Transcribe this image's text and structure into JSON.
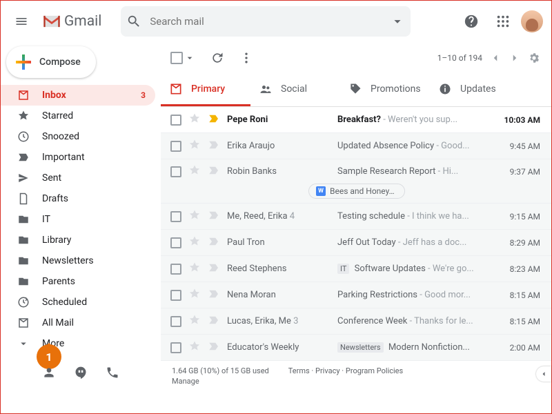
{
  "header": {
    "app_name": "Gmail",
    "search_placeholder": "Search mail"
  },
  "compose_label": "Compose",
  "sidebar": {
    "items": [
      {
        "label": "Inbox",
        "count": "3"
      },
      {
        "label": "Starred"
      },
      {
        "label": "Snoozed"
      },
      {
        "label": "Important"
      },
      {
        "label": "Sent"
      },
      {
        "label": "Drafts"
      },
      {
        "label": "IT"
      },
      {
        "label": "Library"
      },
      {
        "label": "Newsletters"
      },
      {
        "label": "Parents"
      },
      {
        "label": "Scheduled"
      },
      {
        "label": "All Mail"
      },
      {
        "label": "More"
      }
    ]
  },
  "marker": "1",
  "toolbar": {
    "range": "1–10 of 194"
  },
  "tabs": [
    {
      "label": "Primary"
    },
    {
      "label": "Social"
    },
    {
      "label": "Promotions"
    },
    {
      "label": "Updates"
    }
  ],
  "emails": [
    {
      "sender": "Pepe Roni",
      "subject": "Breakfast?",
      "snippet": " - Weren't you sup...",
      "time": "10:03 AM",
      "unread": true,
      "tag": "yellow"
    },
    {
      "sender": "Erika Araujo",
      "subject": "Updated Absence Policy",
      "snippet": " - Good...",
      "time": "9:45 AM"
    },
    {
      "sender": "Robin Banks",
      "subject": "Sample Research Report",
      "snippet": " - Hi...",
      "time": "9:37 AM",
      "attachment": "Bees and Honey…",
      "attach_icon": "W"
    },
    {
      "sender": "Me, Reed, Erika",
      "sender_count": "4",
      "subject": "Testing schedule",
      "snippet": " - I think we ha...",
      "time": "9:15 AM"
    },
    {
      "sender": "Paul Tron",
      "subject": "Jeff Out Today ",
      "snippet": " - Jeff has a doc...",
      "time": "8:29 AM"
    },
    {
      "sender": "Reed Stephens",
      "subject": "Software Updates",
      "snippet": " - We're go...",
      "time": "8:23 AM",
      "badge": "IT"
    },
    {
      "sender": "Nena Moran",
      "subject": "Parking Restrictions",
      "snippet": " - Good mor...",
      "time": "8:15 AM"
    },
    {
      "sender": "Lucas, Erika, Me",
      "sender_count": "3",
      "subject": "Conference Week",
      "snippet": " - Thanks for le...",
      "time": "8:15 AM"
    },
    {
      "sender": "Educator's Weekly",
      "subject": "Modern Nonfiction...",
      "snippet": "",
      "time": "2:00 AM",
      "badge": "Newsletters"
    }
  ],
  "footer": {
    "storage": "1.64 GB (10%) of 15 GB used",
    "manage": "Manage",
    "links": "Terms · Privacy · Program Policies"
  }
}
